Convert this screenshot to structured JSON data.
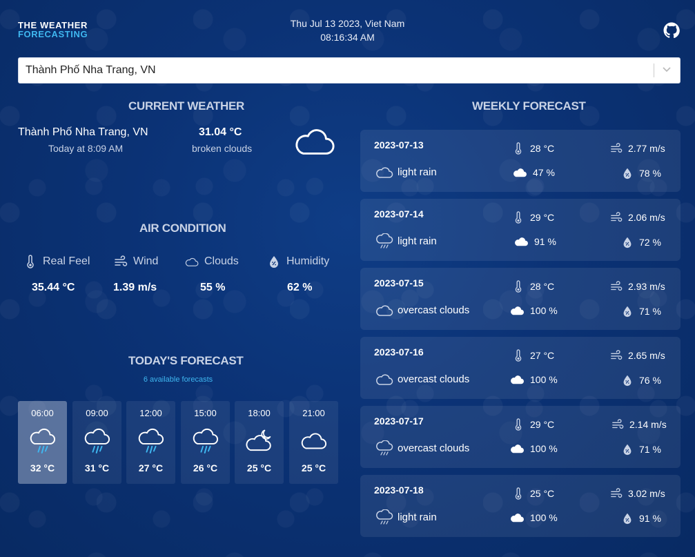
{
  "header": {
    "logo_line1": "The Weather",
    "logo_line2": "Forecasting",
    "date_line": "Thu Jul 13 2023, Viet Nam",
    "time_line": "08:16:34 AM"
  },
  "search": {
    "value": "Thành Phố Nha Trang, VN"
  },
  "current_weather": {
    "title": "CURRENT WEATHER",
    "city": "Thành Phố Nha Trang, VN",
    "time": "Today at 8:09 AM",
    "temperature": "31.04 °C",
    "description": "broken clouds",
    "icon": "cloud-icon"
  },
  "air_condition": {
    "title": "AIR CONDITION",
    "items": [
      {
        "label": "Real Feel",
        "value": "35.44 °C",
        "icon": "thermometer-icon"
      },
      {
        "label": "Wind",
        "value": "1.39 m/s",
        "icon": "wind-icon"
      },
      {
        "label": "Clouds",
        "value": "55 %",
        "icon": "cloud-icon"
      },
      {
        "label": "Humidity",
        "value": "62 %",
        "icon": "humidity-icon"
      }
    ]
  },
  "today_forecast": {
    "title": "TODAY'S FORECAST",
    "subtitle": "6 available forecasts",
    "items": [
      {
        "time": "06:00",
        "temp": "32 °C",
        "icon": "rain-cloud-icon"
      },
      {
        "time": "09:00",
        "temp": "31 °C",
        "icon": "rain-cloud-icon"
      },
      {
        "time": "12:00",
        "temp": "27 °C",
        "icon": "rain-cloud-icon"
      },
      {
        "time": "15:00",
        "temp": "26 °C",
        "icon": "rain-cloud-icon"
      },
      {
        "time": "18:00",
        "temp": "25 °C",
        "icon": "cloud-moon-icon"
      },
      {
        "time": "21:00",
        "temp": "25 °C",
        "icon": "cloud-icon"
      }
    ]
  },
  "weekly_forecast": {
    "title": "WEEKLY FORECAST",
    "days": [
      {
        "date": "2023-07-13",
        "temp": "28 °C",
        "wind": "2.77 m/s",
        "desc": "light rain",
        "clouds": "47 %",
        "humidity": "78 %",
        "icon": "cloud-icon"
      },
      {
        "date": "2023-07-14",
        "temp": "29 °C",
        "wind": "2.06 m/s",
        "desc": "light rain",
        "clouds": "91 %",
        "humidity": "72 %",
        "icon": "rain-cloud-icon"
      },
      {
        "date": "2023-07-15",
        "temp": "28 °C",
        "wind": "2.93 m/s",
        "desc": "overcast clouds",
        "clouds": "100 %",
        "humidity": "71 %",
        "icon": "cloud-icon"
      },
      {
        "date": "2023-07-16",
        "temp": "27 °C",
        "wind": "2.65 m/s",
        "desc": "overcast clouds",
        "clouds": "100 %",
        "humidity": "76 %",
        "icon": "cloud-icon"
      },
      {
        "date": "2023-07-17",
        "temp": "29 °C",
        "wind": "2.14 m/s",
        "desc": "overcast clouds",
        "clouds": "100 %",
        "humidity": "71 %",
        "icon": "rain-cloud-icon"
      },
      {
        "date": "2023-07-18",
        "temp": "25 °C",
        "wind": "3.02 m/s",
        "desc": "light rain",
        "clouds": "100 %",
        "humidity": "91 %",
        "icon": "rain-cloud-icon"
      }
    ]
  },
  "colors": {
    "accent": "#3fb7f0",
    "background": "#0b3275"
  }
}
